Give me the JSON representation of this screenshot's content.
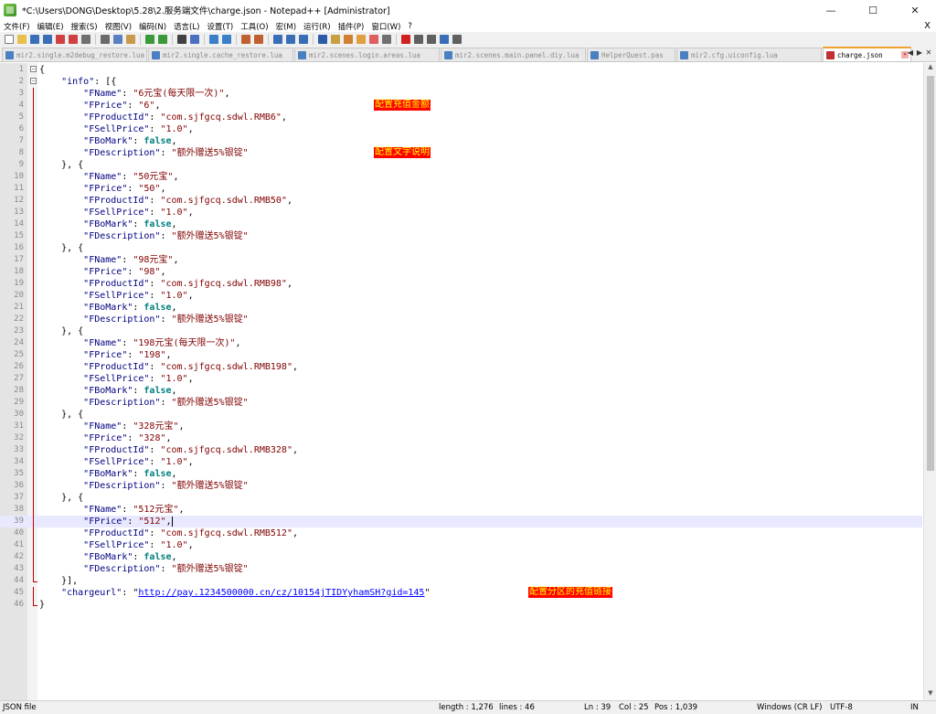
{
  "window": {
    "title": "*C:\\Users\\DONG\\Desktop\\5.28\\2.服务端文件\\charge.json - Notepad++ [Administrator]",
    "minimize": "—",
    "maximize": "☐",
    "close": "✕"
  },
  "menu": [
    "文件(F)",
    "编辑(E)",
    "搜索(S)",
    "视图(V)",
    "编码(N)",
    "语言(L)",
    "设置(T)",
    "工具(O)",
    "宏(M)",
    "运行(R)",
    "插件(P)",
    "窗口(W)",
    "?"
  ],
  "menu_close": "X",
  "toolbar_icons": [
    {
      "name": "new-file-icon",
      "color": "#ffffff",
      "border": "#7a7a7a"
    },
    {
      "name": "open-file-icon",
      "color": "#e8c04a"
    },
    {
      "name": "save-icon",
      "color": "#3a6fb8"
    },
    {
      "name": "save-all-icon",
      "color": "#3a6fb8"
    },
    {
      "name": "close-icon",
      "color": "#d04040"
    },
    {
      "name": "close-all-icon",
      "color": "#d04040"
    },
    {
      "name": "print-icon",
      "color": "#707070"
    },
    "sep",
    {
      "name": "cut-icon",
      "color": "#6a6a6a"
    },
    {
      "name": "copy-icon",
      "color": "#5a80c0"
    },
    {
      "name": "paste-icon",
      "color": "#c89a4a"
    },
    "sep",
    {
      "name": "undo-icon",
      "color": "#3a9a3a"
    },
    {
      "name": "redo-icon",
      "color": "#3a9a3a"
    },
    "sep",
    {
      "name": "find-icon",
      "color": "#404040"
    },
    {
      "name": "replace-icon",
      "color": "#4a70c0"
    },
    "sep",
    {
      "name": "zoom-in-icon",
      "color": "#3a80c8"
    },
    {
      "name": "zoom-out-icon",
      "color": "#3a80c8"
    },
    "sep",
    {
      "name": "sync-vertical-icon",
      "color": "#c06030"
    },
    {
      "name": "sync-horizontal-icon",
      "color": "#c06030"
    },
    "sep",
    {
      "name": "word-wrap-icon",
      "color": "#3a6fb8"
    },
    {
      "name": "show-all-chars-icon",
      "color": "#3a6fb8"
    },
    {
      "name": "indent-guide-icon",
      "color": "#3a6fb8"
    },
    "sep",
    {
      "name": "language-icon",
      "color": "#2a5aa8"
    },
    {
      "name": "doc-map-icon",
      "color": "#c8a040"
    },
    {
      "name": "function-list-icon",
      "color": "#d08030"
    },
    {
      "name": "folder-workspace-icon",
      "color": "#e0a040"
    },
    {
      "name": "monitor-icon",
      "color": "#e06060"
    },
    {
      "name": "eye-icon",
      "color": "#707070"
    },
    "sep",
    {
      "name": "record-macro-icon",
      "color": "#d02020"
    },
    {
      "name": "stop-record-icon",
      "color": "#606060"
    },
    {
      "name": "play-macro-icon",
      "color": "#606060"
    },
    {
      "name": "play-multiple-icon",
      "color": "#3a6fb8"
    },
    {
      "name": "save-macro-icon",
      "color": "#606060"
    }
  ],
  "tabs": [
    {
      "label": "mir2.single.m2debug_restore.lua",
      "active": false
    },
    {
      "label": "mir2.single.cache_restore.lua",
      "active": false
    },
    {
      "label": "mir2.scenes.login.areas.lua",
      "active": false
    },
    {
      "label": "mir2.scenes.main.panel.diy.lua",
      "active": false
    },
    {
      "label": "HelperQuest.pas",
      "active": false,
      "short": true
    },
    {
      "label": "mir2.cfg.uiconfig.lua",
      "active": false
    },
    {
      "label": "charge.json",
      "active": true,
      "short": true
    }
  ],
  "tab_nav": [
    "◀",
    "▶",
    "✕"
  ],
  "code_lines": [
    [
      [
        "op",
        "{"
      ]
    ],
    [
      [
        "op",
        "    "
      ],
      [
        "key",
        "\"info\""
      ],
      [
        "op",
        ": [{"
      ]
    ],
    [
      [
        "op",
        "        "
      ],
      [
        "key",
        "\"FName\""
      ],
      [
        "op",
        ": "
      ],
      [
        "str",
        "\"6元宝(每天限一次)\""
      ],
      [
        "op",
        ","
      ]
    ],
    [
      [
        "op",
        "        "
      ],
      [
        "key",
        "\"FPrice\""
      ],
      [
        "op",
        ": "
      ],
      [
        "str",
        "\"6\""
      ],
      [
        "op",
        ","
      ]
    ],
    [
      [
        "op",
        "        "
      ],
      [
        "key",
        "\"FProductId\""
      ],
      [
        "op",
        ": "
      ],
      [
        "str",
        "\"com.sjfgcq.sdwl.RMB6\""
      ],
      [
        "op",
        ","
      ]
    ],
    [
      [
        "op",
        "        "
      ],
      [
        "key",
        "\"FSellPrice\""
      ],
      [
        "op",
        ": "
      ],
      [
        "str",
        "\"1.0\""
      ],
      [
        "op",
        ","
      ]
    ],
    [
      [
        "op",
        "        "
      ],
      [
        "key",
        "\"FBoMark\""
      ],
      [
        "op",
        ": "
      ],
      [
        "bool",
        "false"
      ],
      [
        "op",
        ","
      ]
    ],
    [
      [
        "op",
        "        "
      ],
      [
        "key",
        "\"FDescription\""
      ],
      [
        "op",
        ": "
      ],
      [
        "str",
        "\"额外赠送5%银锭\""
      ]
    ],
    [
      [
        "op",
        "    }, {"
      ]
    ],
    [
      [
        "op",
        "        "
      ],
      [
        "key",
        "\"FName\""
      ],
      [
        "op",
        ": "
      ],
      [
        "str",
        "\"50元宝\""
      ],
      [
        "op",
        ","
      ]
    ],
    [
      [
        "op",
        "        "
      ],
      [
        "key",
        "\"FPrice\""
      ],
      [
        "op",
        ": "
      ],
      [
        "str",
        "\"50\""
      ],
      [
        "op",
        ","
      ]
    ],
    [
      [
        "op",
        "        "
      ],
      [
        "key",
        "\"FProductId\""
      ],
      [
        "op",
        ": "
      ],
      [
        "str",
        "\"com.sjfgcq.sdwl.RMB50\""
      ],
      [
        "op",
        ","
      ]
    ],
    [
      [
        "op",
        "        "
      ],
      [
        "key",
        "\"FSellPrice\""
      ],
      [
        "op",
        ": "
      ],
      [
        "str",
        "\"1.0\""
      ],
      [
        "op",
        ","
      ]
    ],
    [
      [
        "op",
        "        "
      ],
      [
        "key",
        "\"FBoMark\""
      ],
      [
        "op",
        ": "
      ],
      [
        "bool",
        "false"
      ],
      [
        "op",
        ","
      ]
    ],
    [
      [
        "op",
        "        "
      ],
      [
        "key",
        "\"FDescription\""
      ],
      [
        "op",
        ": "
      ],
      [
        "str",
        "\"额外赠送5%银锭\""
      ]
    ],
    [
      [
        "op",
        "    }, {"
      ]
    ],
    [
      [
        "op",
        "        "
      ],
      [
        "key",
        "\"FName\""
      ],
      [
        "op",
        ": "
      ],
      [
        "str",
        "\"98元宝\""
      ],
      [
        "op",
        ","
      ]
    ],
    [
      [
        "op",
        "        "
      ],
      [
        "key",
        "\"FPrice\""
      ],
      [
        "op",
        ": "
      ],
      [
        "str",
        "\"98\""
      ],
      [
        "op",
        ","
      ]
    ],
    [
      [
        "op",
        "        "
      ],
      [
        "key",
        "\"FProductId\""
      ],
      [
        "op",
        ": "
      ],
      [
        "str",
        "\"com.sjfgcq.sdwl.RMB98\""
      ],
      [
        "op",
        ","
      ]
    ],
    [
      [
        "op",
        "        "
      ],
      [
        "key",
        "\"FSellPrice\""
      ],
      [
        "op",
        ": "
      ],
      [
        "str",
        "\"1.0\""
      ],
      [
        "op",
        ","
      ]
    ],
    [
      [
        "op",
        "        "
      ],
      [
        "key",
        "\"FBoMark\""
      ],
      [
        "op",
        ": "
      ],
      [
        "bool",
        "false"
      ],
      [
        "op",
        ","
      ]
    ],
    [
      [
        "op",
        "        "
      ],
      [
        "key",
        "\"FDescription\""
      ],
      [
        "op",
        ": "
      ],
      [
        "str",
        "\"额外赠送5%银锭\""
      ]
    ],
    [
      [
        "op",
        "    }, {"
      ]
    ],
    [
      [
        "op",
        "        "
      ],
      [
        "key",
        "\"FName\""
      ],
      [
        "op",
        ": "
      ],
      [
        "str",
        "\"198元宝(每天限一次)\""
      ],
      [
        "op",
        ","
      ]
    ],
    [
      [
        "op",
        "        "
      ],
      [
        "key",
        "\"FPrice\""
      ],
      [
        "op",
        ": "
      ],
      [
        "str",
        "\"198\""
      ],
      [
        "op",
        ","
      ]
    ],
    [
      [
        "op",
        "        "
      ],
      [
        "key",
        "\"FProductId\""
      ],
      [
        "op",
        ": "
      ],
      [
        "str",
        "\"com.sjfgcq.sdwl.RMB198\""
      ],
      [
        "op",
        ","
      ]
    ],
    [
      [
        "op",
        "        "
      ],
      [
        "key",
        "\"FSellPrice\""
      ],
      [
        "op",
        ": "
      ],
      [
        "str",
        "\"1.0\""
      ],
      [
        "op",
        ","
      ]
    ],
    [
      [
        "op",
        "        "
      ],
      [
        "key",
        "\"FBoMark\""
      ],
      [
        "op",
        ": "
      ],
      [
        "bool",
        "false"
      ],
      [
        "op",
        ","
      ]
    ],
    [
      [
        "op",
        "        "
      ],
      [
        "key",
        "\"FDescription\""
      ],
      [
        "op",
        ": "
      ],
      [
        "str",
        "\"额外赠送5%银锭\""
      ]
    ],
    [
      [
        "op",
        "    }, {"
      ]
    ],
    [
      [
        "op",
        "        "
      ],
      [
        "key",
        "\"FName\""
      ],
      [
        "op",
        ": "
      ],
      [
        "str",
        "\"328元宝\""
      ],
      [
        "op",
        ","
      ]
    ],
    [
      [
        "op",
        "        "
      ],
      [
        "key",
        "\"FPrice\""
      ],
      [
        "op",
        ": "
      ],
      [
        "str",
        "\"328\""
      ],
      [
        "op",
        ","
      ]
    ],
    [
      [
        "op",
        "        "
      ],
      [
        "key",
        "\"FProductId\""
      ],
      [
        "op",
        ": "
      ],
      [
        "str",
        "\"com.sjfgcq.sdwl.RMB328\""
      ],
      [
        "op",
        ","
      ]
    ],
    [
      [
        "op",
        "        "
      ],
      [
        "key",
        "\"FSellPrice\""
      ],
      [
        "op",
        ": "
      ],
      [
        "str",
        "\"1.0\""
      ],
      [
        "op",
        ","
      ]
    ],
    [
      [
        "op",
        "        "
      ],
      [
        "key",
        "\"FBoMark\""
      ],
      [
        "op",
        ": "
      ],
      [
        "bool",
        "false"
      ],
      [
        "op",
        ","
      ]
    ],
    [
      [
        "op",
        "        "
      ],
      [
        "key",
        "\"FDescription\""
      ],
      [
        "op",
        ": "
      ],
      [
        "str",
        "\"额外赠送5%银锭\""
      ]
    ],
    [
      [
        "op",
        "    }, {"
      ]
    ],
    [
      [
        "op",
        "        "
      ],
      [
        "key",
        "\"FName\""
      ],
      [
        "op",
        ": "
      ],
      [
        "str",
        "\"512元宝\""
      ],
      [
        "op",
        ","
      ]
    ],
    [
      [
        "op",
        "        "
      ],
      [
        "key",
        "\"FPrice\""
      ],
      [
        "op",
        ": "
      ],
      [
        "str",
        "\"512\""
      ],
      [
        "op",
        ","
      ]
    ],
    [
      [
        "op",
        "        "
      ],
      [
        "key",
        "\"FProductId\""
      ],
      [
        "op",
        ": "
      ],
      [
        "str",
        "\"com.sjfgcq.sdwl.RMB512\""
      ],
      [
        "op",
        ","
      ]
    ],
    [
      [
        "op",
        "        "
      ],
      [
        "key",
        "\"FSellPrice\""
      ],
      [
        "op",
        ": "
      ],
      [
        "str",
        "\"1.0\""
      ],
      [
        "op",
        ","
      ]
    ],
    [
      [
        "op",
        "        "
      ],
      [
        "key",
        "\"FBoMark\""
      ],
      [
        "op",
        ": "
      ],
      [
        "bool",
        "false"
      ],
      [
        "op",
        ","
      ]
    ],
    [
      [
        "op",
        "        "
      ],
      [
        "key",
        "\"FDescription\""
      ],
      [
        "op",
        ": "
      ],
      [
        "str",
        "\"额外赠送5%银锭\""
      ]
    ],
    [
      [
        "op",
        "    }],"
      ]
    ],
    [
      [
        "op",
        "    "
      ],
      [
        "key",
        "\"chargeurl\""
      ],
      [
        "op",
        ": \""
      ],
      [
        "link",
        "http://pay.1234500000.cn/cz/10154jTIDYyhamSH?gid=145"
      ],
      [
        "op",
        "\""
      ]
    ],
    [
      [
        "op",
        "}"
      ]
    ]
  ],
  "current_line": 39,
  "annotations": [
    {
      "line": 4,
      "text": "配置充值金额"
    },
    {
      "line": 8,
      "text": "配置文字说明"
    },
    {
      "line": 45,
      "text": "配置分区的充值链接"
    }
  ],
  "annotation_colors": {
    "background": "#ff0000",
    "text": "#ffff00"
  },
  "syntax_colors": {
    "key": "#000080",
    "string": "#800000",
    "bool": "#008080",
    "link": "#0000ff"
  },
  "status": {
    "file_type": "JSON file",
    "length": "length : 1,276",
    "lines": "lines : 46",
    "ln": "Ln : 39",
    "col": "Col : 25",
    "pos": "Pos : 1,039",
    "eol": "Windows (CR LF)",
    "encoding": "UTF-8",
    "mode": "IN"
  }
}
